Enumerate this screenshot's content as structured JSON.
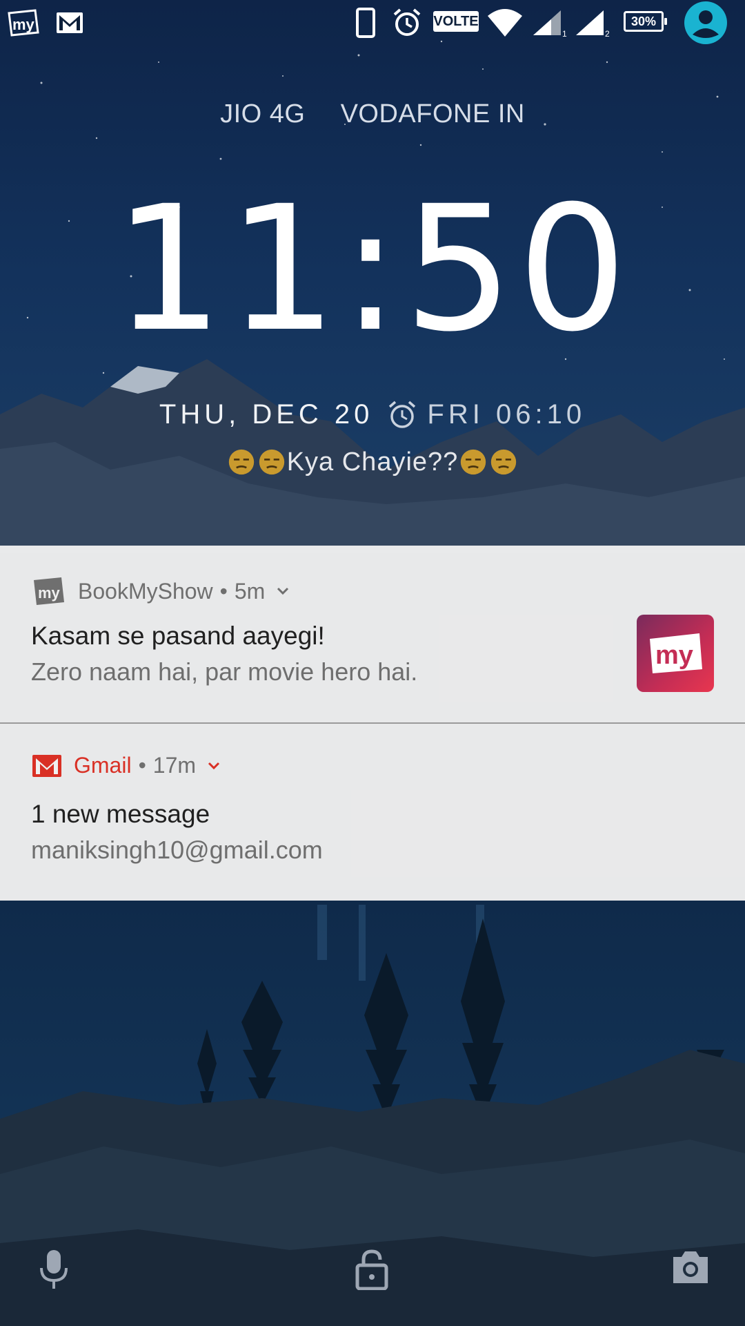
{
  "status_bar": {
    "left_icons": [
      "bookmyshow-icon",
      "gmail-icon"
    ],
    "right_icons": [
      "phone-icon",
      "alarm-icon",
      "volte-badge",
      "wifi-icon",
      "signal-1-icon",
      "signal-2-icon",
      "battery-icon",
      "user-avatar-icon"
    ],
    "volte_label": "VOLTE",
    "battery_label": "30%"
  },
  "lockscreen": {
    "carrier_1": "JIO 4G",
    "carrier_2": "VODAFONE IN",
    "clock_hours": "11",
    "clock_colon": ":",
    "clock_minutes": "50",
    "date": "THU, DEC 20",
    "next_alarm": "FRI 06:10",
    "owner_info": "Kya Chayie??"
  },
  "notifications": [
    {
      "app": "BookMyShow",
      "separator": "•",
      "time": "5m",
      "title": "Kasam se pasand aayegi!",
      "text": "Zero naam hai, par movie hero hai.",
      "icon": "bookmyshow-icon"
    },
    {
      "app": "Gmail",
      "separator": "•",
      "time": "17m",
      "title": "1 new message",
      "text": "maniksingh10@gmail.com",
      "icon": "gmail-icon",
      "accent": "#d93025"
    }
  ],
  "bottom": {
    "left": "microphone-icon",
    "center": "lock-icon",
    "right": "camera-icon"
  }
}
